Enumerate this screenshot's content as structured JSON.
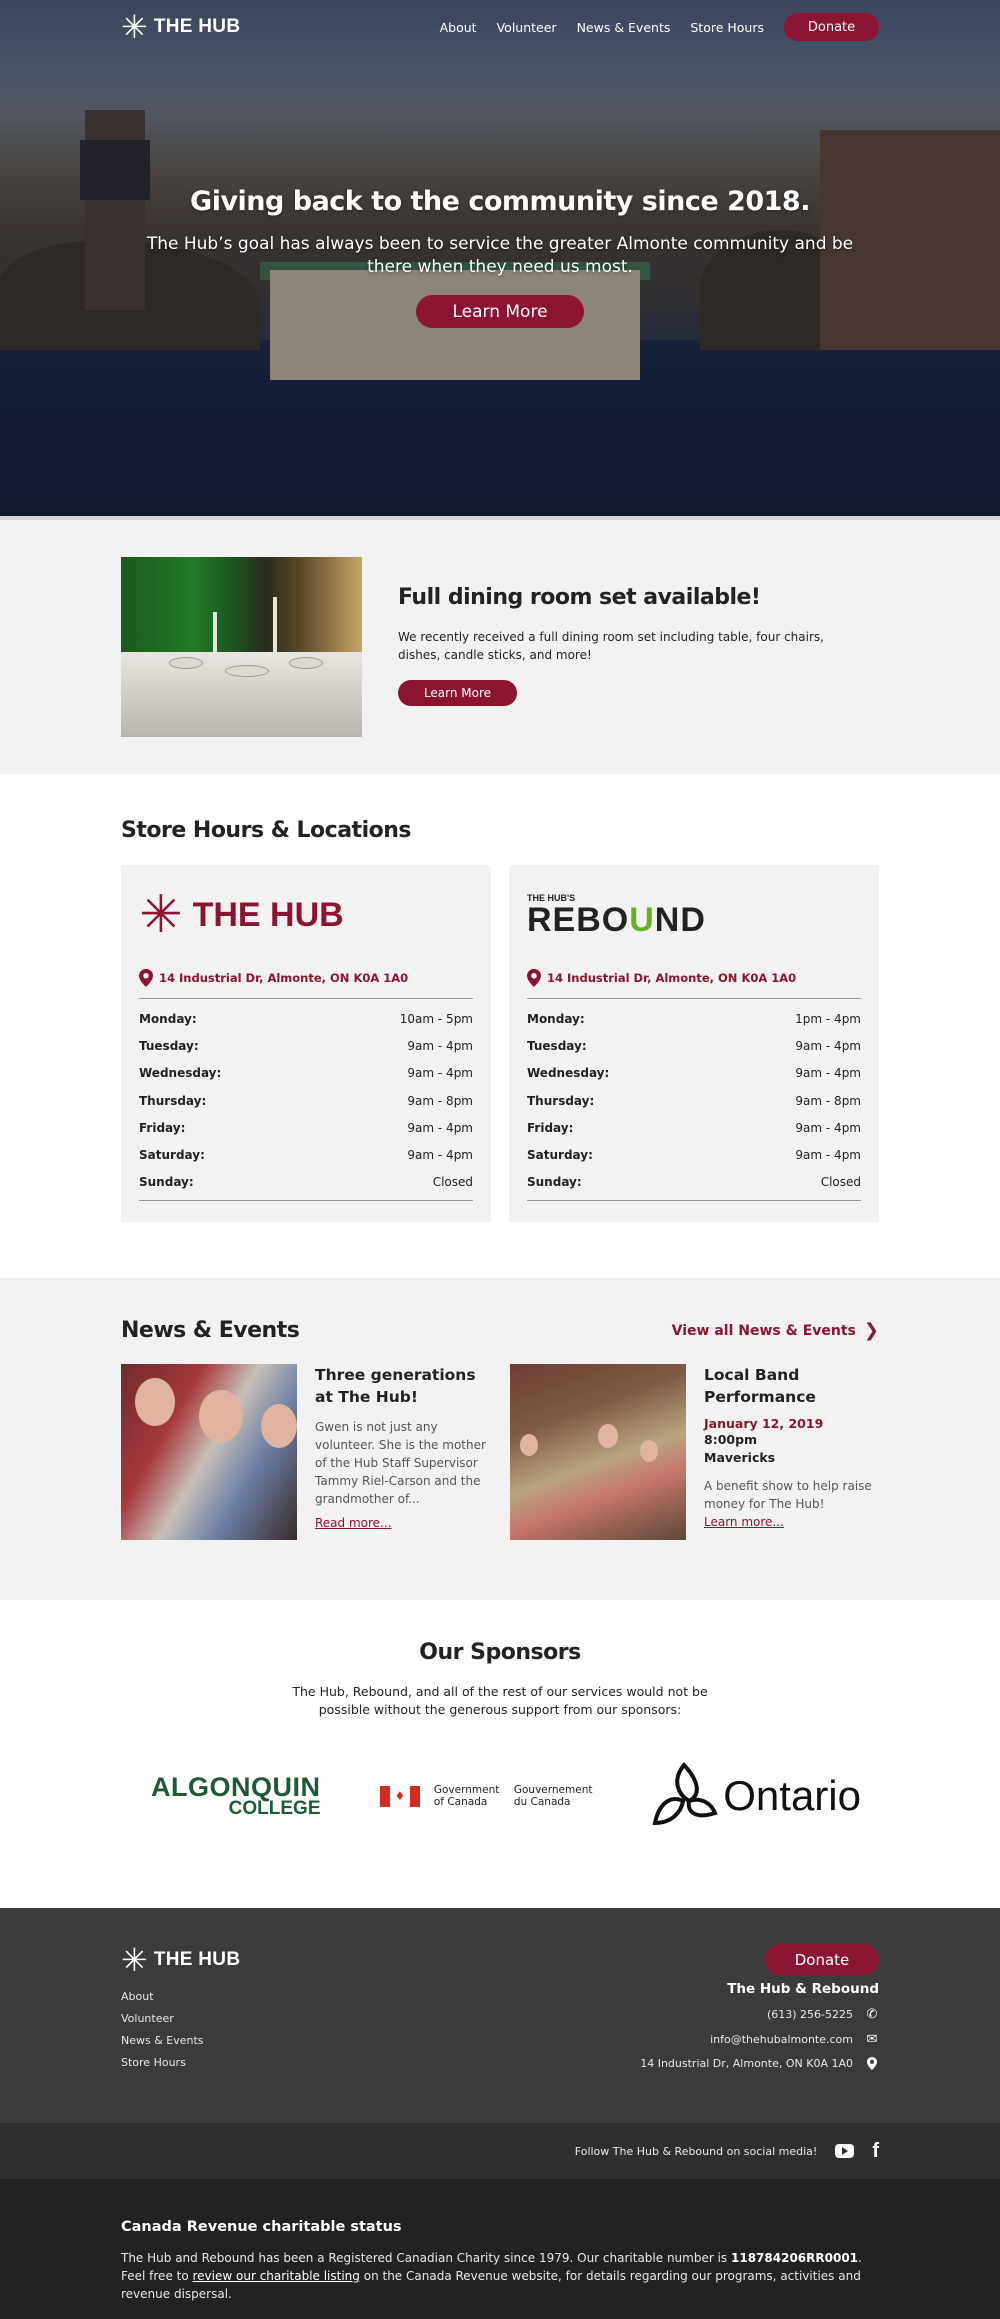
{
  "header": {
    "logo_text": "THE HUB",
    "nav": [
      "About",
      "Volunteer",
      "News & Events",
      "Store Hours"
    ],
    "donate_label": "Donate"
  },
  "hero": {
    "title": "Giving back to the community since 2018.",
    "subtitle": "The Hub’s goal has always been to service the greater Almonte community and be there when they need us most.",
    "button_label": "Learn More"
  },
  "feature": {
    "title": "Full dining room set available!",
    "body": "We recently received a full dining room set including table, four chairs, dishes, candle sticks, and more!",
    "button_label": "Learn More"
  },
  "store_hours": {
    "title": "Store Hours & Locations",
    "locations": [
      {
        "logo_text": "THE HUB",
        "address": "14 Industrial Dr, Almonte, ON K0A 1A0",
        "hours": [
          {
            "day": "Monday:",
            "time": "10am - 5pm"
          },
          {
            "day": "Tuesday:",
            "time": "9am - 4pm"
          },
          {
            "day": "Wednesday:",
            "time": "9am - 4pm"
          },
          {
            "day": "Thursday:",
            "time": "9am - 8pm"
          },
          {
            "day": "Friday:",
            "time": "9am - 4pm"
          },
          {
            "day": "Saturday:",
            "time": "9am - 4pm"
          },
          {
            "day": "Sunday:",
            "time": "Closed"
          }
        ]
      },
      {
        "logo_pre": "THE HUB'S",
        "logo_text_a": "REBO",
        "logo_text_u": "U",
        "logo_text_b": "ND",
        "address": "14 Industrial Dr, Almonte, ON K0A 1A0",
        "hours": [
          {
            "day": "Monday:",
            "time": "1pm - 4pm"
          },
          {
            "day": "Tuesday:",
            "time": "9am - 4pm"
          },
          {
            "day": "Wednesday:",
            "time": "9am - 4pm"
          },
          {
            "day": "Thursday:",
            "time": "9am - 8pm"
          },
          {
            "day": "Friday:",
            "time": "9am - 4pm"
          },
          {
            "day": "Saturday:",
            "time": "9am - 4pm"
          },
          {
            "day": "Sunday:",
            "time": "Closed"
          }
        ]
      }
    ]
  },
  "news": {
    "title": "News & Events",
    "view_all": "View all News & Events",
    "items": [
      {
        "title": "Three generations at The Hub!",
        "excerpt": "Gwen is not just any volunteer. She is the mother of the Hub Staff Supervisor Tammy Riel-Carson and the grandmother of...",
        "link": "Read more..."
      },
      {
        "title": "Local Band Performance",
        "date": "January 12, 2019",
        "time": "8:00pm",
        "venue": "Mavericks",
        "excerpt": "A benefit show to help raise money for The Hub!",
        "link": "Learn more..."
      }
    ]
  },
  "sponsors": {
    "title": "Our Sponsors",
    "body": "The Hub, Rebound, and all of the rest of our services would not be possible without the generous support from our sponsors:",
    "algonquin_l1": "ALGONQUIN",
    "algonquin_l2": "COLLEGE",
    "goc_en": "Government of Canada",
    "goc_fr": "Gouvernement du Canada",
    "ontario": "Ontario"
  },
  "footer": {
    "logo_text": "THE HUB",
    "nav": [
      "About",
      "Volunteer",
      "News & Events",
      "Store Hours"
    ],
    "donate_label": "Donate",
    "org": "The Hub & Rebound",
    "phone": "(613) 256-5225",
    "email": "info@thehubalmonte.com",
    "address": "14 Industrial Dr, Almonte, ON K0A 1A0",
    "social_text": "Follow The Hub & Rebound on social media!"
  },
  "legal": {
    "title": "Canada Revenue charitable status",
    "text_1": "The Hub and Rebound has been a Registered Canadian Charity since 1979. Our charitable number is ",
    "charity_number": "118784206RR0001",
    "text_2": ". Feel free to ",
    "link": "review our charitable listing",
    "text_3": " on the Canada Revenue website, for details regarding our programs, activities and revenue dispersal."
  },
  "colors": {
    "brand": "#8b1530",
    "rebound_green": "#6ab023",
    "section_gray": "#f2f2f2",
    "footer_dark": "#3b3b3b"
  }
}
